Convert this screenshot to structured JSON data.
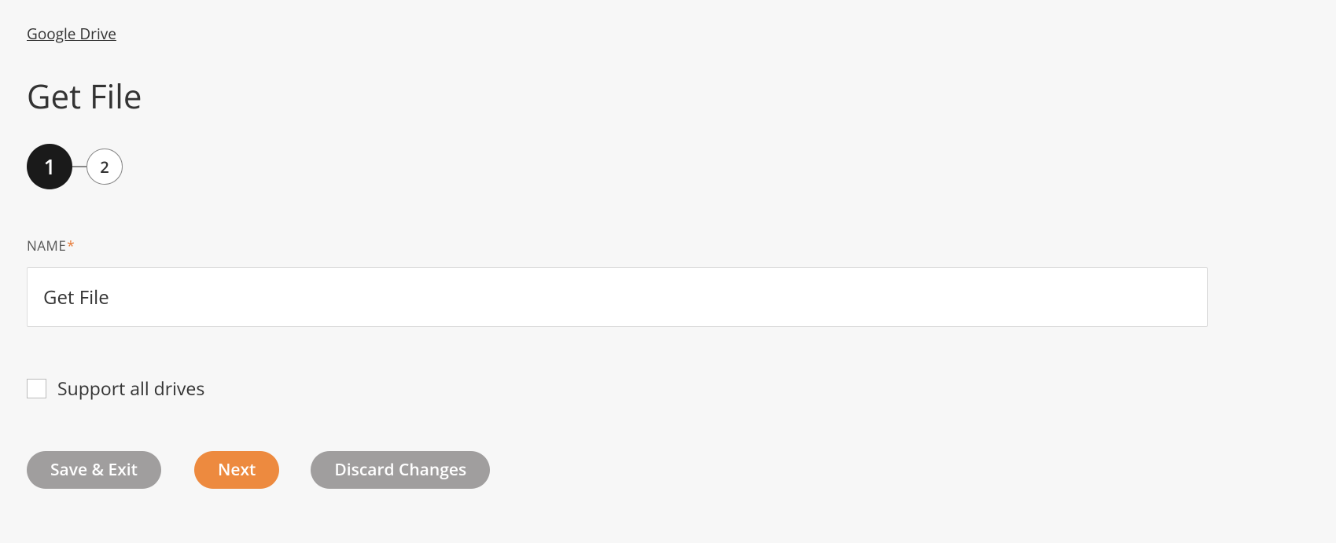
{
  "breadcrumb": "Google Drive",
  "page_title": "Get File",
  "stepper": {
    "steps": [
      "1",
      "2"
    ],
    "active_index": 0
  },
  "form": {
    "name_label": "NAME",
    "name_value": "Get File",
    "support_all_drives_label": "Support all drives",
    "support_all_drives_checked": false
  },
  "buttons": {
    "save_exit": "Save & Exit",
    "next": "Next",
    "discard": "Discard Changes"
  }
}
